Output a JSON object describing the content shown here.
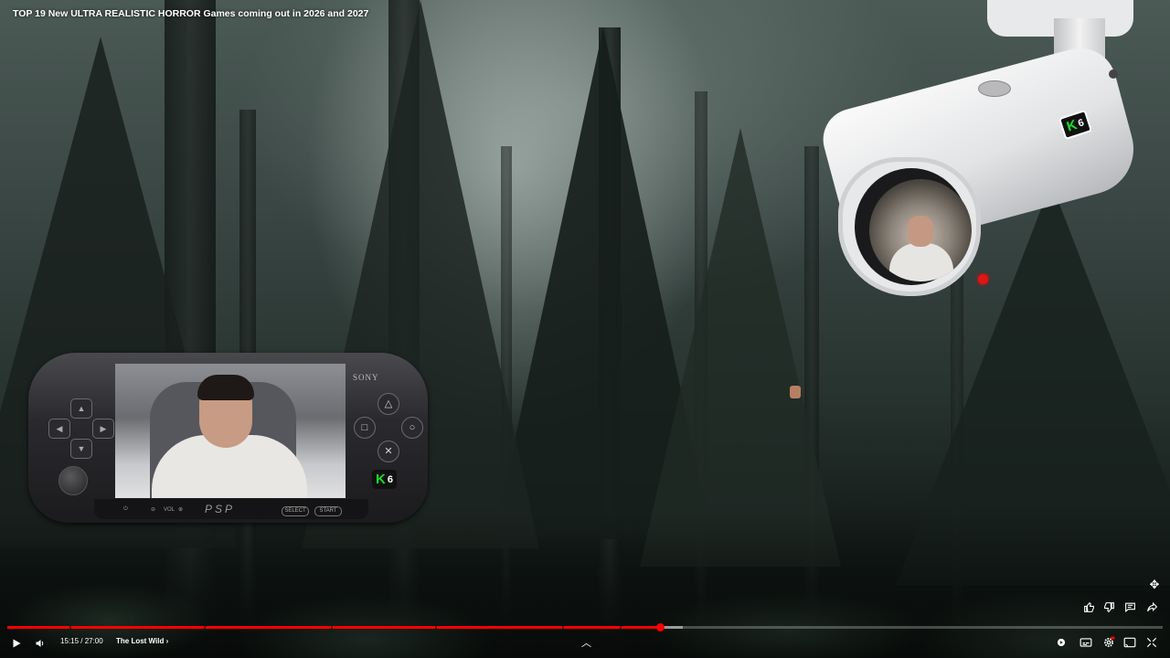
{
  "video": {
    "title": "TOP 19 New ULTRA REALISTIC HORROR Games coming out in 2026 and 2027"
  },
  "overlays": {
    "psp": {
      "brand": "SONY",
      "logo": "PSP",
      "vol_label": "VOL",
      "select_label": "SELECT",
      "start_label": "START",
      "channel_badge": "6"
    },
    "camera": {
      "channel_badge": "6"
    }
  },
  "side_actions": {
    "icons": [
      "like-icon",
      "dislike-icon",
      "comments-icon",
      "share-icon"
    ]
  },
  "player": {
    "time_display": "15:15 / 27:00",
    "chapter_title": "The Lost Wild",
    "progress": {
      "played_fraction": 0.565,
      "buffered_fraction": 0.585,
      "chapter_marks": [
        0.054,
        0.17,
        0.28,
        0.37,
        0.48,
        0.53
      ]
    },
    "icons": {
      "play": "play-icon",
      "volume": "volume-icon",
      "autoplay": "autoplay-toggle-icon",
      "subtitles": "subtitles-icon",
      "settings": "settings-icon",
      "miniplayer": "miniplayer-icon",
      "fullscreen": "fullscreen-icon"
    },
    "accent_color": "#ff0000"
  }
}
